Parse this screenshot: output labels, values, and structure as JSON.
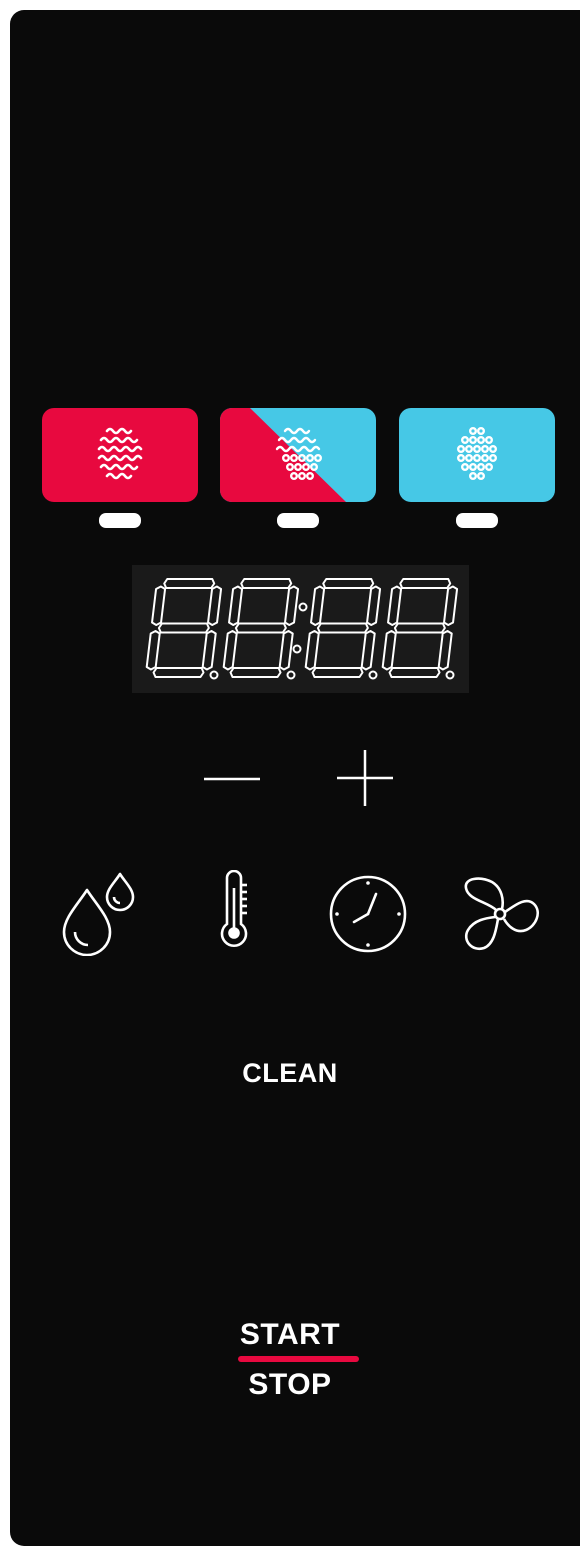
{
  "colors": {
    "panel": "#0a0a0a",
    "convection": "#e8093f",
    "steam": "#46c8e6",
    "indicator": "#ffffff",
    "display_bg": "#1a1a1a",
    "display_segment": "#ffffff",
    "start_underline": "#e8093f"
  },
  "modes": [
    {
      "name": "convection",
      "icon": "heat-waves-icon",
      "indicator_on": true
    },
    {
      "name": "combination",
      "icon": "heat-and-steam-icon",
      "indicator_on": true
    },
    {
      "name": "steam",
      "icon": "steam-dots-icon",
      "indicator_on": true
    }
  ],
  "display": {
    "digits": "88:88",
    "decimal_points": 4
  },
  "adjust": {
    "minus_icon": "minus-icon",
    "plus_icon": "plus-icon"
  },
  "functions": [
    {
      "icon": "humidity-drops-icon"
    },
    {
      "icon": "thermometer-icon"
    },
    {
      "icon": "clock-icon"
    },
    {
      "icon": "fan-icon"
    }
  ],
  "buttons": {
    "clean_label": "CLEAN",
    "start_label": "START",
    "stop_label": "STOP"
  }
}
